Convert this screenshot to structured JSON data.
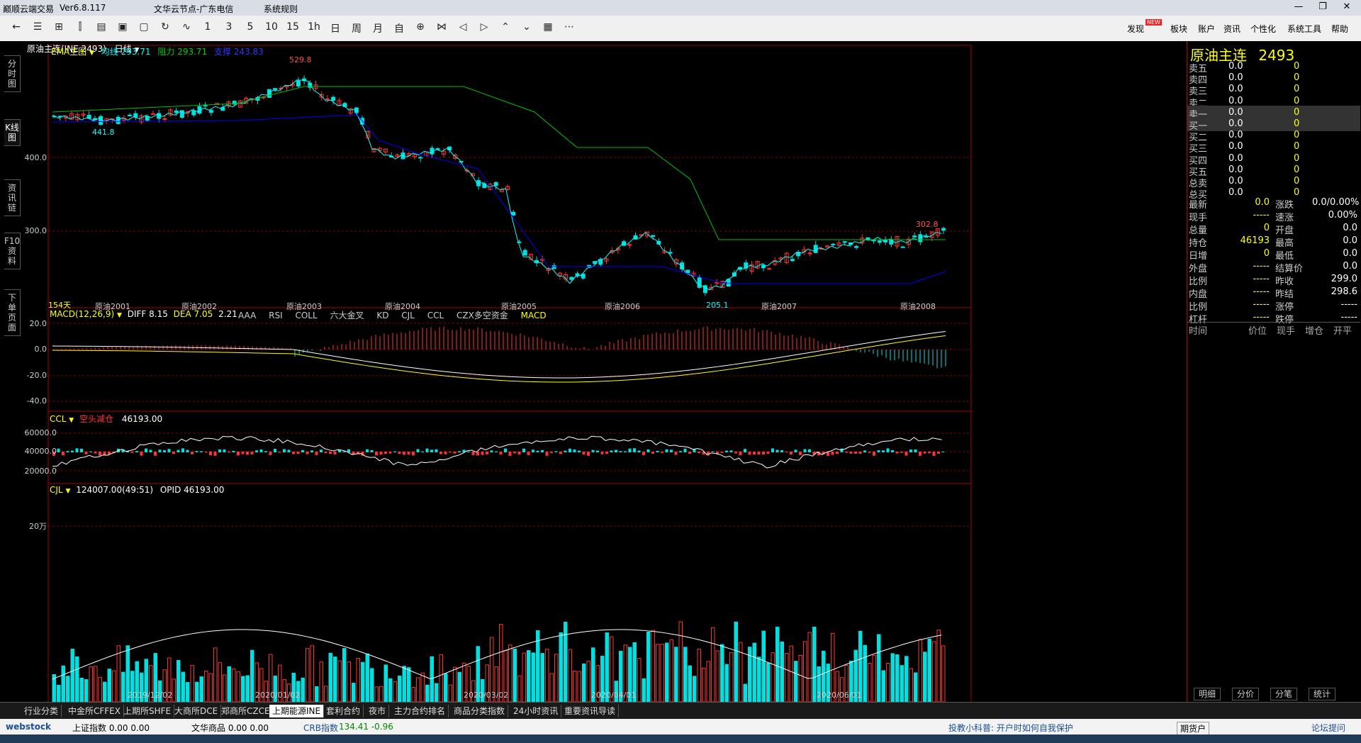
{
  "window": {
    "app_title": "巅顺云端交易",
    "version": "Ver6.8.117",
    "server": "文华云节点-广东电信",
    "menu": "系统规则"
  },
  "toolbar": {
    "periods": [
      "1",
      "3",
      "5",
      "10",
      "15",
      "1h",
      "日",
      "周",
      "月",
      "自"
    ],
    "right_menu": [
      "发现",
      "板块",
      "账户",
      "资讯",
      "个性化",
      "系统工具",
      "帮助"
    ],
    "new_badge": "NEW"
  },
  "left_tabs": [
    "分时图",
    "K线图",
    "资讯链",
    "F10资料",
    "下单页面"
  ],
  "chart": {
    "contract_label": "原油主连(INE 2493)",
    "period_label": "日线",
    "main_indicator": "EMA主图",
    "ma_label": "均线 293.71",
    "resist_label": "阻力 293.71",
    "support_label": "支撑 243.83",
    "high_mark": "529.8",
    "low_mark_left": "441.8",
    "low_mark_mid": "205.1",
    "last_mark": "302.8",
    "days_label": "154天",
    "y_labels": [
      "400.0",
      "300.0"
    ],
    "contract_markers": [
      "原油2001",
      "原油2002",
      "原油2003",
      "原油2004",
      "原油2005",
      "原油2006",
      "原油2007",
      "原油2008"
    ],
    "macd_label": "MACD(12,26,9)",
    "macd_diff": "DIFF 8.15",
    "macd_dea": "DEA 7.05",
    "macd_val": "2.21",
    "indicator_tabs": [
      "AAA",
      "RSI",
      "COLL",
      "六大金叉",
      "KD",
      "CJL",
      "CCL",
      "CZX多空资金",
      "MACD"
    ],
    "macd_y": [
      "20.0",
      "0.0",
      "-20.0",
      "-40.0"
    ],
    "ccl_label": "CCL",
    "ccl_sub": "空头减仓",
    "ccl_val": "46193.00",
    "ccl_y": [
      "60000.0",
      "40000.0",
      "20000.0"
    ],
    "cjl_label": "CJL",
    "cjl_val": "124007.00(49:51)",
    "cjl_opid": "OPID 46193.00",
    "cjl_y": "20万",
    "dates": [
      "2019/12/02",
      "2020/01/02",
      "2020/03/02",
      "2020/04/01",
      "2020/06/01"
    ],
    "colors": {
      "up": "#ff3232",
      "down": "#00e0e0",
      "ma": "#00ffff",
      "resist": "#00c000",
      "support": "#0000ff"
    }
  },
  "quote": {
    "title": "原油主连",
    "code": "2493",
    "book": [
      {
        "label": "卖五",
        "price": "0.0",
        "vol": "0"
      },
      {
        "label": "卖四",
        "price": "0.0",
        "vol": "0"
      },
      {
        "label": "卖三",
        "price": "0.0",
        "vol": "0"
      },
      {
        "label": "卖二",
        "price": "0.0",
        "vol": "0"
      },
      {
        "label": "卖一",
        "price": "0.0",
        "vol": "0"
      },
      {
        "label": "买一",
        "price": "0.0",
        "vol": "0"
      },
      {
        "label": "买二",
        "price": "0.0",
        "vol": "0"
      },
      {
        "label": "买三",
        "price": "0.0",
        "vol": "0"
      },
      {
        "label": "买四",
        "price": "0.0",
        "vol": "0"
      },
      {
        "label": "买五",
        "price": "0.0",
        "vol": "0"
      },
      {
        "label": "总卖",
        "price": "0.0",
        "vol": "0"
      },
      {
        "label": "总买",
        "price": "0.0",
        "vol": "0"
      }
    ],
    "stats": [
      {
        "l1": "最新",
        "v1": "0.0",
        "l2": "涨跌",
        "v2": "0.0/0.00%"
      },
      {
        "l1": "现手",
        "v1": "-----",
        "l2": "速涨",
        "v2": "0.00%"
      },
      {
        "l1": "总量",
        "v1": "0",
        "l2": "开盘",
        "v2": "0.0"
      },
      {
        "l1": "持仓",
        "v1": "46193",
        "l2": "最高",
        "v2": "0.0"
      },
      {
        "l1": "日增",
        "v1": "0",
        "l2": "最低",
        "v2": "0.0"
      },
      {
        "l1": "外盘",
        "v1": "-----",
        "l2": "结算价",
        "v2": "0.0"
      },
      {
        "l1": "比例",
        "v1": "-----",
        "l2": "昨收",
        "v2": "299.0"
      },
      {
        "l1": "内盘",
        "v1": "-----",
        "l2": "昨结",
        "v2": "298.6"
      },
      {
        "l1": "比例",
        "v1": "-----",
        "l2": "涨停",
        "v2": "-----"
      },
      {
        "l1": "杠杆",
        "v1": "-----",
        "l2": "跌停",
        "v2": "-----"
      }
    ],
    "tick_headers": [
      "时间",
      "价位",
      "现手",
      "增仓",
      "开平"
    ],
    "bottom_tabs": [
      "明细",
      "分价",
      "分笔",
      "统计"
    ]
  },
  "bottom_tabs": [
    "行业分类",
    "中金所CFFEX",
    "上期所SHFE",
    "大商所DCE",
    "郑商所CZCE",
    "上期能源INE",
    "套利合约",
    "夜市",
    "主力合约排名",
    "商品分类指数",
    "24小时资讯",
    "重要资讯导读"
  ],
  "status": {
    "logo": "webstock",
    "idx1": "上证指数  0.00  0.00",
    "idx2": "文华商品  0.00  0.00",
    "crb": "CRB指数",
    "crb_val": "134.41  -0.96",
    "tip": "投教小科普: 开户时如何自我保护",
    "btn1": "期货户",
    "btn2": "论坛提问"
  }
}
